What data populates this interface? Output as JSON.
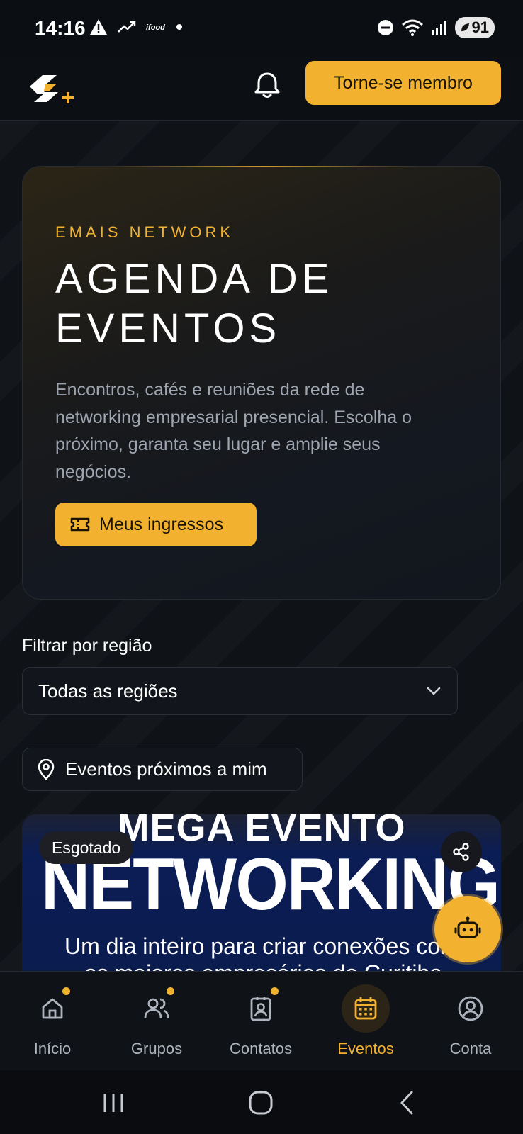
{
  "status_bar": {
    "time": "14:16",
    "battery": "91"
  },
  "header": {
    "logo_icon": "emais-logo-icon",
    "bell_icon": "bell-icon",
    "member_button": "Torne-se membro"
  },
  "hero": {
    "eyebrow": "EMAIS NETWORK",
    "title_line1": "AGENDA DE",
    "title_line2": "EVENTOS",
    "description": "Encontros, cafés e reuniões da rede de networking empresarial presencial. Escolha o próximo, garanta seu lugar e amplie seus negócios.",
    "tickets_button": "Meus ingressos"
  },
  "filter": {
    "label": "Filtrar por região",
    "selected": "Todas as regiões"
  },
  "near_button": "Eventos próximos a mim",
  "event_card": {
    "badge": "Esgotado",
    "banner_top": "MEGA EVENTO",
    "banner_title": "NETWORKING",
    "banner_sub1": "Um dia inteiro para criar conexões com",
    "banner_sub2": "os maiores empresários de Curitiba"
  },
  "bottom_nav": {
    "items": [
      {
        "label": "Início",
        "icon": "home-icon",
        "dot": true
      },
      {
        "label": "Grupos",
        "icon": "users-icon",
        "dot": true
      },
      {
        "label": "Contatos",
        "icon": "contact-card-icon",
        "dot": true
      },
      {
        "label": "Eventos",
        "icon": "calendar-icon",
        "dot": false,
        "active": true
      },
      {
        "label": "Conta",
        "icon": "account-icon",
        "dot": false
      }
    ]
  },
  "colors": {
    "accent": "#f2b22f",
    "background": "#0f1318"
  }
}
